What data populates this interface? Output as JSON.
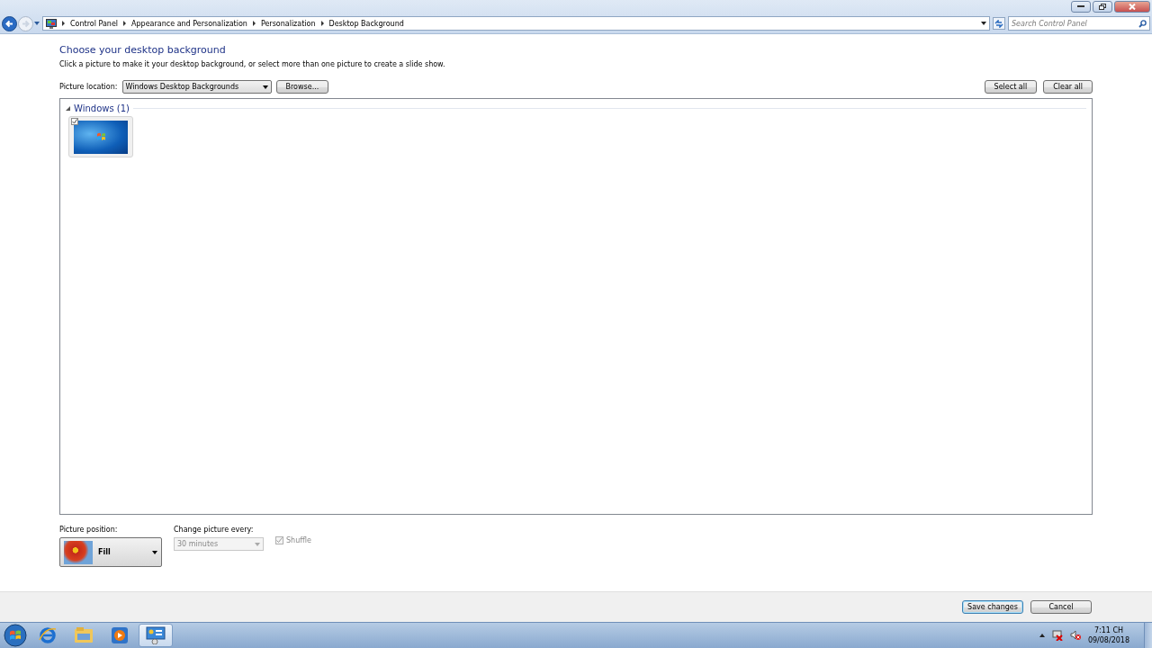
{
  "breadcrumb": [
    "Control Panel",
    "Appearance and Personalization",
    "Personalization",
    "Desktop Background"
  ],
  "search": {
    "placeholder": "Search Control Panel"
  },
  "heading": "Choose your desktop background",
  "description": "Click a picture to make it your desktop background, or select more than one picture to create a slide show.",
  "picture_location": {
    "label": "Picture location:",
    "value": "Windows Desktop Backgrounds"
  },
  "browse_button": "Browse...",
  "select_all_button": "Select all",
  "clear_all_button": "Clear all",
  "groups": [
    {
      "title": "Windows (1)",
      "expanded": true,
      "pictures": [
        {
          "checked": true
        }
      ]
    }
  ],
  "picture_position": {
    "label": "Picture position:",
    "value": "Fill"
  },
  "change_picture": {
    "label": "Change picture every:",
    "value": "30 minutes",
    "disabled": true
  },
  "shuffle": {
    "label": "Shuffle",
    "checked": true,
    "disabled": true
  },
  "buttons": [
    {
      "label": "Save changes",
      "default": true
    },
    {
      "label": "Cancel",
      "default": false
    }
  ],
  "taskbar": {
    "items": [
      {
        "kind": "browser",
        "selected": false
      },
      {
        "kind": "folder",
        "selected": false
      },
      {
        "kind": "media",
        "selected": false
      },
      {
        "kind": "control-panel",
        "selected": true
      }
    ]
  },
  "clock": {
    "time": "7:11 CH",
    "date": "09/08/2018"
  }
}
